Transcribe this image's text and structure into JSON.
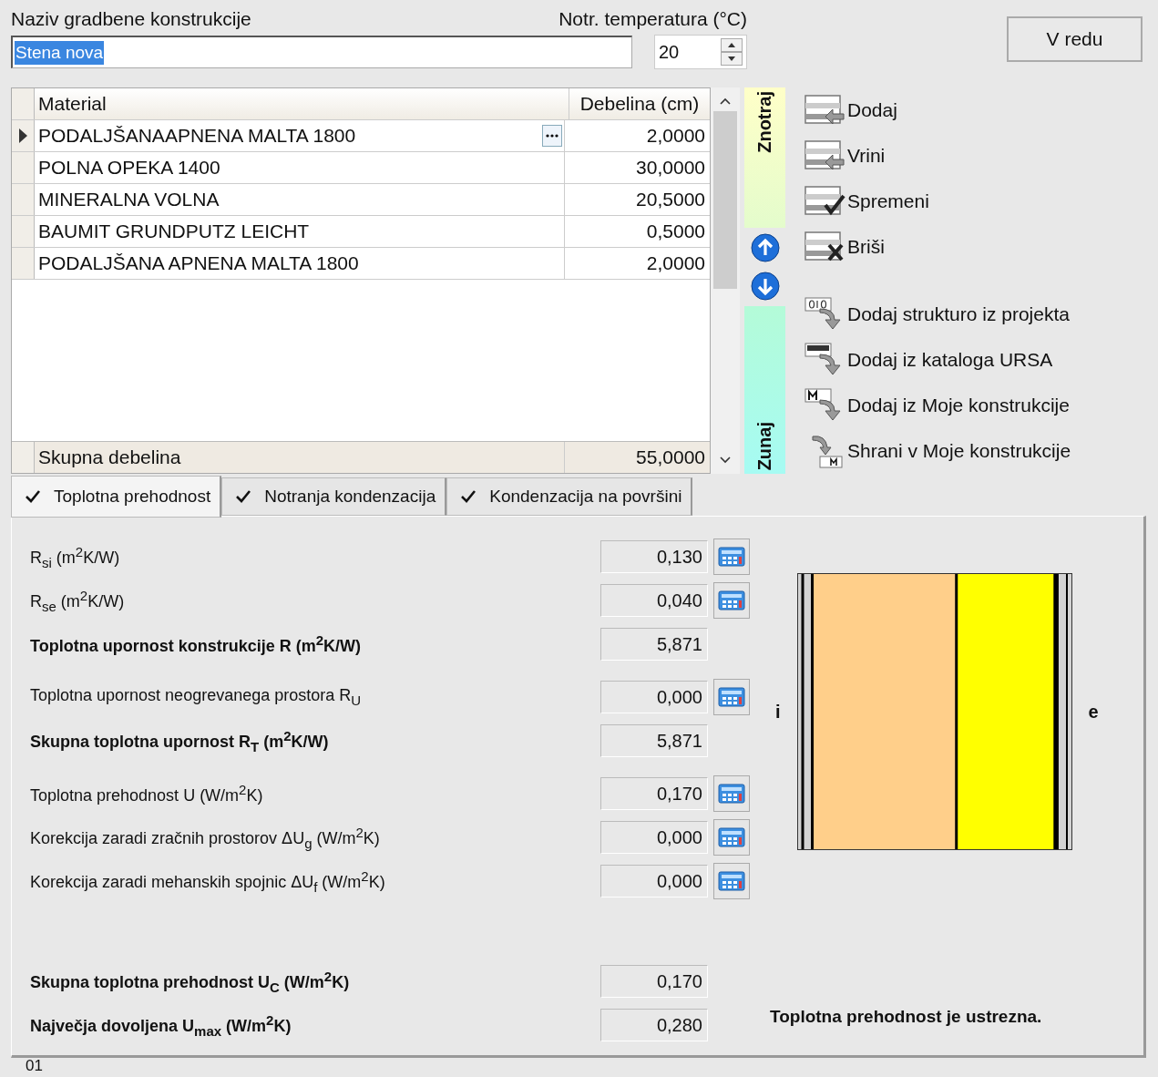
{
  "name_field": {
    "label": "Naziv gradbene konstrukcije",
    "value": "Stena nova",
    "selected": true
  },
  "temperature": {
    "label": "Notr. temperatura (°C)",
    "value": "20"
  },
  "ok_button": {
    "label": "V redu"
  },
  "table": {
    "columns": [
      "Material",
      "Debelina (cm)"
    ],
    "rows": [
      {
        "material": "PODALJŠANAAPNENA MALTA 1800",
        "thickness": "2,0000",
        "selected": true,
        "color": "#d3d3d3"
      },
      {
        "material": "POLNA OPEKA 1400",
        "thickness": "30,0000",
        "selected": false,
        "color": "#ffcf8a"
      },
      {
        "material": "MINERALNA VOLNA",
        "thickness": "20,5000",
        "selected": false,
        "color": "#ffff00"
      },
      {
        "material": "BAUMIT GRUNDPUTZ LEICHT",
        "thickness": "0,5000",
        "selected": false,
        "color": "#000000"
      },
      {
        "material": "PODALJŠANA APNENA MALTA 1800",
        "thickness": "2,0000",
        "selected": false,
        "color": "#d3d3d3"
      }
    ],
    "total": {
      "label": "Skupna debelina",
      "value": "55,0000"
    }
  },
  "side_labels": {
    "inside": "Znotraj",
    "outside": "Zunaj"
  },
  "actions": [
    {
      "label": "Dodaj",
      "kind": "add"
    },
    {
      "label": "Vrini",
      "kind": "insert"
    },
    {
      "label": "Spremeni",
      "kind": "edit"
    },
    {
      "label": "Briši",
      "kind": "delete"
    },
    {
      "label": "Dodaj strukturo iz projekta",
      "kind": "project"
    },
    {
      "label": "Dodaj iz kataloga URSA",
      "kind": "catalog"
    },
    {
      "label": "Dodaj iz Moje konstrukcije",
      "kind": "load"
    },
    {
      "label": "Shrani v Moje konstrukcije",
      "kind": "save"
    }
  ],
  "tabs": [
    {
      "label": "Toplotna prehodnost",
      "selected": true,
      "checked": true
    },
    {
      "label": "Notranja kondenzacija",
      "selected": false,
      "checked": true
    },
    {
      "label": "Kondenzacija na površini",
      "selected": false,
      "checked": true
    }
  ],
  "results": [
    {
      "label": "R$_{si}$ (m$^{2}$K/W)",
      "value": "0,130",
      "bold": false,
      "calculator": true
    },
    {
      "label": "R$_{se}$ (m$^{2}$K/W)",
      "value": "0,040",
      "bold": false,
      "calculator": true
    },
    {
      "label": "Toplotna upornost konstrukcije R (m$^{2}$K/W)",
      "value": "5,871",
      "bold": true,
      "calculator": false
    },
    {
      "label": "Toplotna upornost neogrevanega prostora R$_{U}$",
      "value": "0,000",
      "bold": false,
      "calculator": true
    },
    {
      "label": "Skupna toplotna upornost R$_{T}$ (m$^{2}$K/W)",
      "value": "5,871",
      "bold": true,
      "calculator": false
    },
    {
      "label": "Toplotna prehodnost  U (W/m$^{2}$K)",
      "value": "0,170",
      "bold": false,
      "calculator": true
    },
    {
      "label": "Korekcija zaradi zračnih prostorov ΔU$_{g}$ (W/m$^{2}$K)",
      "value": "0,000",
      "bold": false,
      "calculator": true
    },
    {
      "label": "Korekcija zaradi mehanskih spojnic ΔU$_{f}$ (W/m$^{2}$K)",
      "value": "0,000",
      "bold": false,
      "calculator": true
    },
    {
      "label": "Skupna toplotna prehodnost U$_{C}$ (W/m$^{2}$K)",
      "value": "0,170",
      "bold": true,
      "calculator": false
    },
    {
      "label": "Največja dovoljena U$_{max}$ (W/m$^{2}$K)",
      "value": "0,280",
      "bold": true,
      "calculator": false
    }
  ],
  "wall_labels": {
    "inside": "i",
    "outside": "e"
  },
  "verdict": "Toplotna prehodnost je ustrezna.",
  "footer": "01"
}
